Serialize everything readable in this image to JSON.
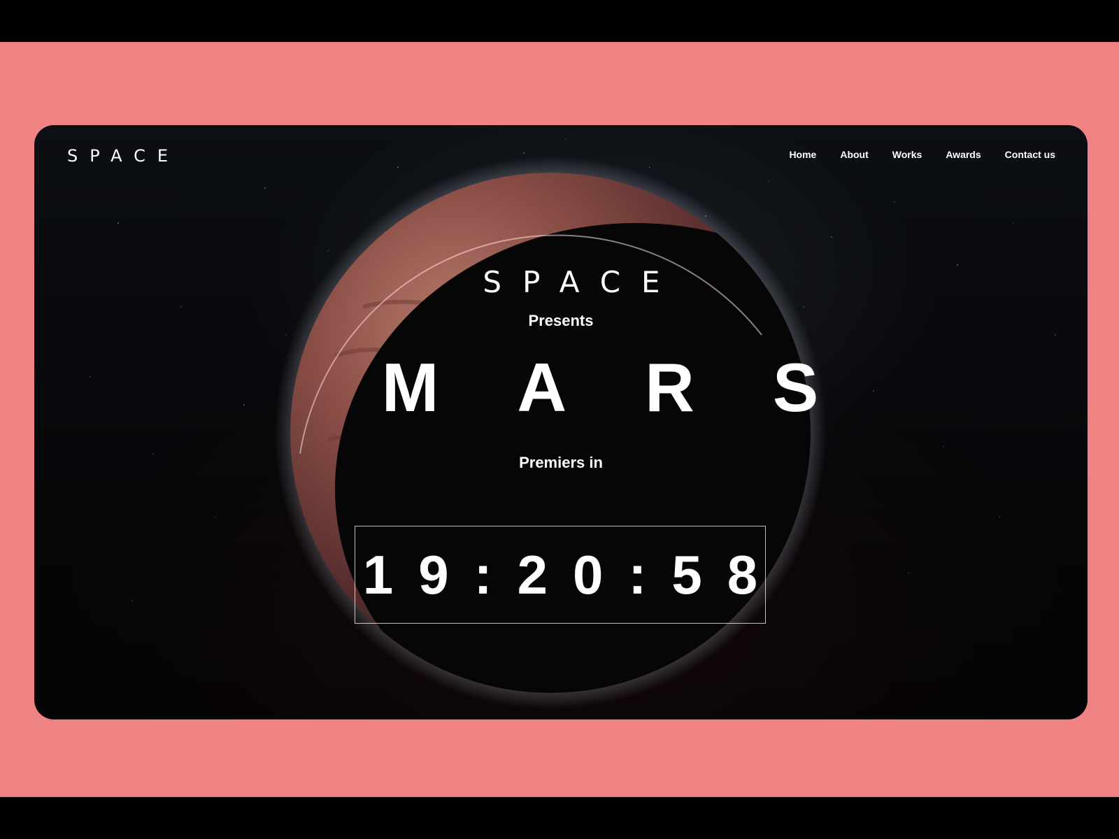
{
  "colors": {
    "stage_background": "#ef8282",
    "window_background": "#07080b",
    "text": "#ffffff",
    "planet_accent": "#a8685f"
  },
  "header": {
    "logo": "SPACE",
    "nav": [
      {
        "label": "Home"
      },
      {
        "label": "About"
      },
      {
        "label": "Works"
      },
      {
        "label": "Awards"
      },
      {
        "label": "Contact us"
      }
    ]
  },
  "hero": {
    "brand": "SPACE",
    "presents": "Presents",
    "title": "MARS",
    "premiers": "Premiers in",
    "countdown": "19:20:58"
  },
  "background": {
    "planet_icon": "mars-planet-icon",
    "starfield_icon": "starfield-icon"
  }
}
